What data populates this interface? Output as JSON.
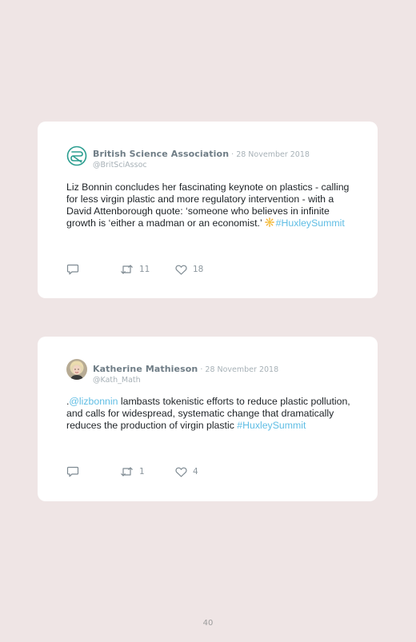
{
  "tweets": [
    {
      "author": "British Science Association",
      "date": " · 28 November 2018",
      "handle": "@BritSciAssoc",
      "text": "Liz Bonnin concludes her fascinating keynote on plastics - calling for less virgin plastic and more regulatory intervention - with a David Attenborough quote: ‘someone who believes in infinite growth is ‘either a madman or an economist.’ ",
      "emoji_icon": "sparkle-emoji",
      "hashtag": "#HuxleySummit",
      "reply_icon": "reply-icon",
      "retweet_icon": "retweet-icon",
      "retweets": "11",
      "like_icon": "heart-icon",
      "likes": "18"
    },
    {
      "author": "Katherine Mathieson",
      "date": " · 28 November 2018",
      "handle": "@Kath_Math",
      "text_prefix": ".",
      "mention": "@lizbonnin",
      "text": " lambasts tokenistic efforts to reduce plastic pollution, and calls for widespread, systematic change that dramatically reduces the production of virgin plastic ",
      "hashtag": "#HuxleySummit",
      "reply_icon": "reply-icon",
      "retweet_icon": "retweet-icon",
      "retweets": "1",
      "like_icon": "heart-icon",
      "likes": "4"
    }
  ],
  "page_number": "40",
  "colors": {
    "background": "#efe5e5",
    "card": "#ffffff",
    "link": "#5fbde4",
    "logo": "#2a9d8f",
    "muted": "#a7b1b7"
  }
}
